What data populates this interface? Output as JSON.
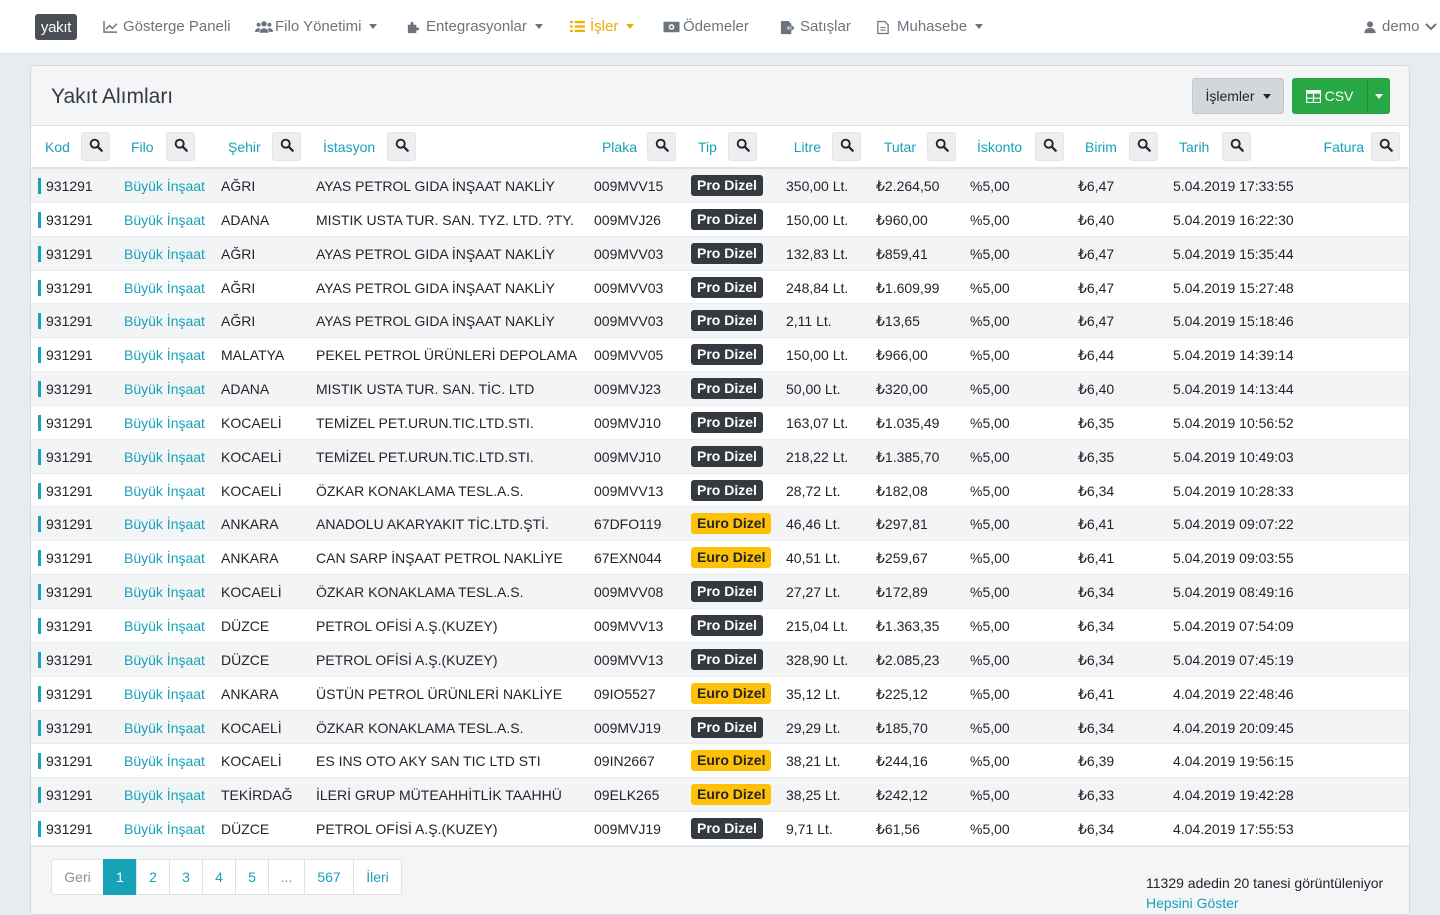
{
  "brand": "yakıt",
  "nav": [
    {
      "label": "Gösterge Paneli",
      "icon": "chart-icon",
      "caret": false,
      "active": false
    },
    {
      "label": "Filo Yönetimi",
      "icon": "users-icon",
      "caret": true,
      "active": false
    },
    {
      "label": "Entegrasyonlar",
      "icon": "puzzle-icon",
      "caret": true,
      "active": false
    },
    {
      "label": "İşler",
      "icon": "list-icon",
      "caret": true,
      "active": true
    },
    {
      "label": "Ödemeler",
      "icon": "money-icon",
      "caret": false,
      "active": false
    },
    {
      "label": "Satışlar",
      "icon": "file-export-icon",
      "caret": false,
      "active": false
    },
    {
      "label": "Muhasebe",
      "icon": "file-icon",
      "caret": true,
      "active": false
    }
  ],
  "user": {
    "name": "demo",
    "icon": "user-icon"
  },
  "colors": {
    "accent": "#17a2b8",
    "active_nav": "#f0ad00",
    "csv_button": "#28a745",
    "badge_pro": "#343a40",
    "badge_euro": "#ffc107"
  },
  "card": {
    "title": "Yakıt Alımları",
    "actions_label": "İşlemler",
    "csv_label": "CSV"
  },
  "columns": [
    "Kod",
    "Filo",
    "Şehir",
    "İstasyon",
    "Plaka",
    "Tip",
    "Litre",
    "Tutar",
    "İskonto",
    "Birim",
    "Tarih",
    "Fatura"
  ],
  "rows": [
    [
      "931291",
      "Büyük İnşaat",
      "AĞRI",
      "AYAS PETROL GIDA İNŞAAT NAKLİY",
      "009MVV15",
      "Pro Dizel",
      "350,00 Lt.",
      "₺2.264,50",
      "%5,00",
      "₺6,47",
      "5.04.2019 17:33:55"
    ],
    [
      "931291",
      "Büyük İnşaat",
      "ADANA",
      "MISTIK USTA TUR. SAN. TYZ. LTD. ?TY.",
      "009MVJ26",
      "Pro Dizel",
      "150,00 Lt.",
      "₺960,00",
      "%5,00",
      "₺6,40",
      "5.04.2019 16:22:30"
    ],
    [
      "931291",
      "Büyük İnşaat",
      "AĞRI",
      "AYAS PETROL GIDA İNŞAAT NAKLİY",
      "009MVV03",
      "Pro Dizel",
      "132,83 Lt.",
      "₺859,41",
      "%5,00",
      "₺6,47",
      "5.04.2019 15:35:44"
    ],
    [
      "931291",
      "Büyük İnşaat",
      "AĞRI",
      "AYAS PETROL GIDA İNŞAAT NAKLİY",
      "009MVV03",
      "Pro Dizel",
      "248,84 Lt.",
      "₺1.609,99",
      "%5,00",
      "₺6,47",
      "5.04.2019 15:27:48"
    ],
    [
      "931291",
      "Büyük İnşaat",
      "AĞRI",
      "AYAS PETROL GIDA İNŞAAT NAKLİY",
      "009MVV03",
      "Pro Dizel",
      "2,11 Lt.",
      "₺13,65",
      "%5,00",
      "₺6,47",
      "5.04.2019 15:18:46"
    ],
    [
      "931291",
      "Büyük İnşaat",
      "MALATYA",
      "PEKEL PETROL ÜRÜNLERİ DEPOLAMA",
      "009MVV05",
      "Pro Dizel",
      "150,00 Lt.",
      "₺966,00",
      "%5,00",
      "₺6,44",
      "5.04.2019 14:39:14"
    ],
    [
      "931291",
      "Büyük İnşaat",
      "ADANA",
      "MISTIK USTA TUR. SAN. TİC. LTD",
      "009MVJ23",
      "Pro Dizel",
      "50,00 Lt.",
      "₺320,00",
      "%5,00",
      "₺6,40",
      "5.04.2019 14:13:44"
    ],
    [
      "931291",
      "Büyük İnşaat",
      "KOCAELİ",
      "TEMİZEL PET.URUN.TIC.LTD.STI.",
      "009MVJ10",
      "Pro Dizel",
      "163,07 Lt.",
      "₺1.035,49",
      "%5,00",
      "₺6,35",
      "5.04.2019 10:56:52"
    ],
    [
      "931291",
      "Büyük İnşaat",
      "KOCAELİ",
      "TEMİZEL PET.URUN.TIC.LTD.STI.",
      "009MVJ10",
      "Pro Dizel",
      "218,22 Lt.",
      "₺1.385,70",
      "%5,00",
      "₺6,35",
      "5.04.2019 10:49:03"
    ],
    [
      "931291",
      "Büyük İnşaat",
      "KOCAELİ",
      "ÖZKAR KONAKLAMA TESL.A.S.",
      "009MVV13",
      "Pro Dizel",
      "28,72 Lt.",
      "₺182,08",
      "%5,00",
      "₺6,34",
      "5.04.2019 10:28:33"
    ],
    [
      "931291",
      "Büyük İnşaat",
      "ANKARA",
      "ANADOLU AKARYAKIT TİC.LTD.ŞTİ.",
      "67DFO119",
      "Euro Dizel",
      "46,46 Lt.",
      "₺297,81",
      "%5,00",
      "₺6,41",
      "5.04.2019 09:07:22"
    ],
    [
      "931291",
      "Büyük İnşaat",
      "ANKARA",
      "CAN SARP İNŞAAT PETROL NAKLİYE",
      "67EXN044",
      "Euro Dizel",
      "40,51 Lt.",
      "₺259,67",
      "%5,00",
      "₺6,41",
      "5.04.2019 09:03:55"
    ],
    [
      "931291",
      "Büyük İnşaat",
      "KOCAELİ",
      "ÖZKAR KONAKLAMA TESL.A.S.",
      "009MVV08",
      "Pro Dizel",
      "27,27 Lt.",
      "₺172,89",
      "%5,00",
      "₺6,34",
      "5.04.2019 08:49:16"
    ],
    [
      "931291",
      "Büyük İnşaat",
      "DÜZCE",
      "PETROL OFİSİ A.Ş.(KUZEY)",
      "009MVV13",
      "Pro Dizel",
      "215,04 Lt.",
      "₺1.363,35",
      "%5,00",
      "₺6,34",
      "5.04.2019 07:54:09"
    ],
    [
      "931291",
      "Büyük İnşaat",
      "DÜZCE",
      "PETROL OFİSİ A.Ş.(KUZEY)",
      "009MVV13",
      "Pro Dizel",
      "328,90 Lt.",
      "₺2.085,23",
      "%5,00",
      "₺6,34",
      "5.04.2019 07:45:19"
    ],
    [
      "931291",
      "Büyük İnşaat",
      "ANKARA",
      "ÜSTÜN PETROL ÜRÜNLERİ NAKLİYE",
      "09IO5527",
      "Euro Dizel",
      "35,12 Lt.",
      "₺225,12",
      "%5,00",
      "₺6,41",
      "4.04.2019 22:48:46"
    ],
    [
      "931291",
      "Büyük İnşaat",
      "KOCAELİ",
      "ÖZKAR KONAKLAMA TESL.A.S.",
      "009MVJ19",
      "Pro Dizel",
      "29,29 Lt.",
      "₺185,70",
      "%5,00",
      "₺6,34",
      "4.04.2019 20:09:45"
    ],
    [
      "931291",
      "Büyük İnşaat",
      "KOCAELİ",
      "ES INS OTO AKY SAN TIC LTD STI",
      "09IN2667",
      "Euro Dizel",
      "38,21 Lt.",
      "₺244,16",
      "%5,00",
      "₺6,39",
      "4.04.2019 19:56:15"
    ],
    [
      "931291",
      "Büyük İnşaat",
      "TEKİRDAĞ",
      "İLERİ GRUP MÜTEAHHİTLİK TAAHHÜ",
      "09ELK265",
      "Euro Dizel",
      "38,25 Lt.",
      "₺242,12",
      "%5,00",
      "₺6,33",
      "4.04.2019 19:42:28"
    ],
    [
      "931291",
      "Büyük İnşaat",
      "DÜZCE",
      "PETROL OFİSİ A.Ş.(KUZEY)",
      "009MVJ19",
      "Pro Dizel",
      "9,71 Lt.",
      "₺61,56",
      "%5,00",
      "₺6,34",
      "4.04.2019 17:55:53"
    ]
  ],
  "pagination": {
    "prev": "Geri",
    "pages": [
      "1",
      "2",
      "3",
      "4",
      "5",
      "...",
      "567"
    ],
    "current": "1",
    "next": "İleri"
  },
  "footer": {
    "count_text": "11329 adedin 20 tanesi görüntüleniyor",
    "show_all": "Hepsini Göster"
  }
}
